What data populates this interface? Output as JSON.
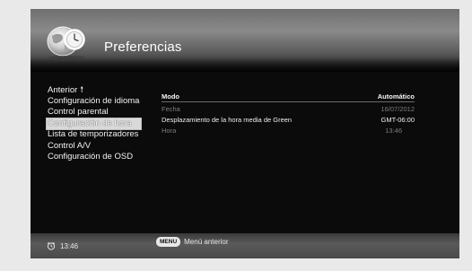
{
  "header": {
    "title": "Preferencias",
    "logo_icon": "globe-clock-icon"
  },
  "menu": {
    "back_label": "Anterior",
    "back_icon": "up-arrow-icon",
    "items": [
      {
        "label": "Configuración de idioma",
        "selected": false
      },
      {
        "label": "Control parental",
        "selected": false
      },
      {
        "label": "Configuración de hora",
        "selected": true
      },
      {
        "label": "Lista de temporizadores",
        "selected": false
      },
      {
        "label": "Control A/V",
        "selected": false
      },
      {
        "label": "Configuración de OSD",
        "selected": false
      }
    ]
  },
  "settings": {
    "rows": [
      {
        "label": "Modo",
        "value": "Automático",
        "style": "header"
      },
      {
        "label": "Fecha",
        "value": "16/07/2012",
        "style": "dim"
      },
      {
        "label": "Desplazamiento de la hora media de Green",
        "value": "GMT-06:00",
        "style": "bright"
      },
      {
        "label": "Hora",
        "value": "13:46",
        "style": "dim"
      }
    ]
  },
  "footer": {
    "clock_icon": "alarm-clock-icon",
    "time": "13:46",
    "menu_key": "MENU",
    "menu_hint": "Menú anterior"
  },
  "colors": {
    "screen_bg": "#0b0b0b",
    "highlight": "#d9d9d9",
    "dim_text": "#7e7e7e",
    "frame": "#e9e9e9"
  }
}
